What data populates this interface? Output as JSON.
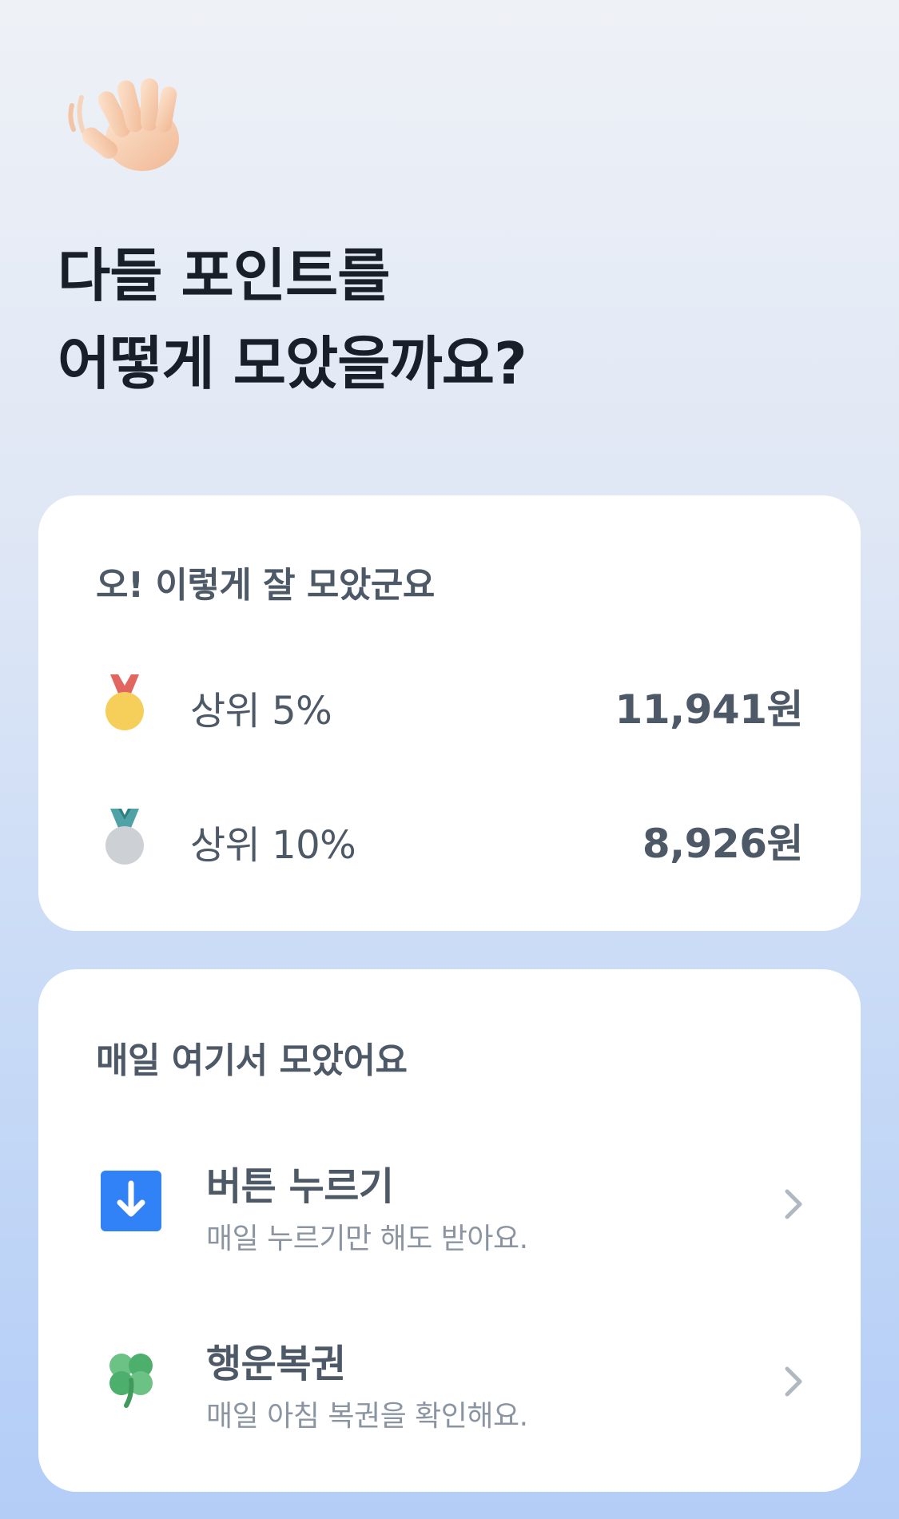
{
  "hero": {
    "icon": "waving-hand-icon",
    "headline_line1": "다들 포인트를",
    "headline_line2": "어떻게 모았을까요?"
  },
  "rank_card": {
    "title": "오! 이렇게 잘 모았군요",
    "rows": [
      {
        "icon": "gold-medal-icon",
        "label": "상위 5%",
        "amount": "11,941원"
      },
      {
        "icon": "silver-medal-icon",
        "label": "상위 10%",
        "amount": "8,926원"
      }
    ]
  },
  "ways_card": {
    "title": "매일 여기서 모았어요",
    "items": [
      {
        "icon": "download-arrow-icon",
        "title": "버튼 누르기",
        "subtitle": "매일 누르기만 해도 받아요."
      },
      {
        "icon": "four-leaf-clover-icon",
        "title": "행운복권",
        "subtitle": "매일 아침 복권을 확인해요."
      }
    ]
  },
  "colors": {
    "accent_blue": "#3182f6",
    "clover_green": "#4caf6b",
    "gold": "#f6cf5a",
    "silver": "#cdd1d6",
    "text_primary": "#191f28",
    "text_secondary": "#4e5968",
    "text_tertiary": "#8b95a1"
  }
}
